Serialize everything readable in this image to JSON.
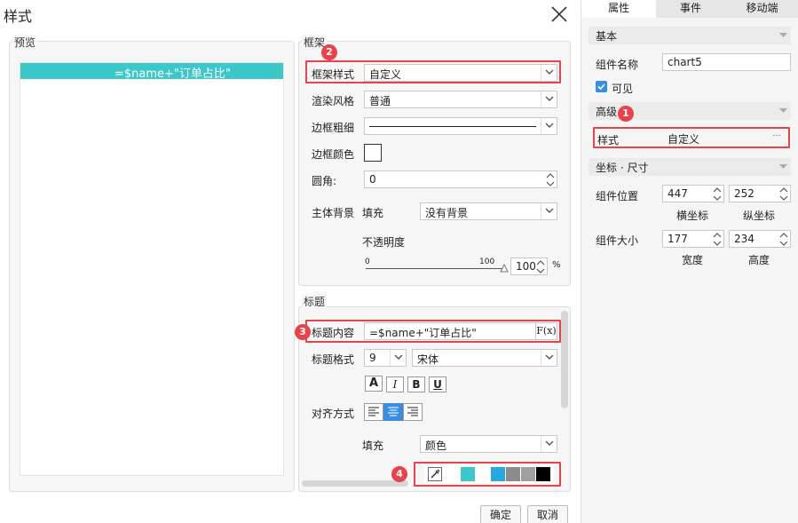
{
  "dialog": {
    "title": "样式",
    "confirm_label": "确定",
    "cancel_label": "取消",
    "preview": {
      "group_label": "预览",
      "title_text": "=$name+\"订单占比\"",
      "title_bar_color": "#3cc8c8"
    },
    "frame": {
      "group_label": "框架",
      "frame_style_label": "框架样式",
      "frame_style_value": "自定义",
      "render_style_label": "渲染风格",
      "render_style_value": "普通",
      "border_width_label": "边框粗细",
      "border_color_label": "边框颜色",
      "corner_label": "圆角:",
      "corner_value": "0",
      "background_label": "主体背景",
      "fill_label": "填充",
      "fill_value": "没有背景",
      "opacity_label": "不透明度",
      "slider_min": "0",
      "slider_max": "100",
      "opacity_value": "100",
      "opacity_unit": "%",
      "opacity_level_percent": 100
    },
    "title_section": {
      "group_label": "标题",
      "content_label": "标题内容",
      "content_value": "=$name+\"订单占比\"",
      "formula_button": "F(x)",
      "format_label": "标题格式",
      "font_size_value": "9",
      "font_family_value": "宋体",
      "format_buttons": [
        "A",
        "I",
        "B",
        "U"
      ],
      "align_label": "对齐方式",
      "fill_label": "填充",
      "fill_value": "颜色",
      "swatch_colors": [
        "#ffffff",
        "#3cc8c8",
        "#ffffff",
        "#29a8e0",
        "#8c8c8c",
        "#a0a0a0",
        "#000000"
      ]
    },
    "badges": {
      "b2": "2",
      "b3": "3",
      "b4": "4"
    }
  },
  "right_panel": {
    "tabs": [
      "属性",
      "事件",
      "移动端"
    ],
    "basic_section": "基本",
    "component_name_label": "组件名称",
    "component_name_value": "chart5",
    "visible_label": "可见",
    "advanced_section": "高级",
    "style_label": "样式",
    "style_value": "自定义",
    "style_button": "···",
    "coord_section": "坐标 · 尺寸",
    "position_label": "组件位置",
    "position_x": "447",
    "position_y": "252",
    "x_label": "横坐标",
    "y_label": "纵坐标",
    "size_label": "组件大小",
    "width_value": "177",
    "height_value": "234",
    "width_label": "宽度",
    "height_label": "高度",
    "badge1": "1"
  },
  "colors": {
    "accent": "#3c8de0",
    "highlight": "#e8424a",
    "check": "#3c8de0"
  }
}
